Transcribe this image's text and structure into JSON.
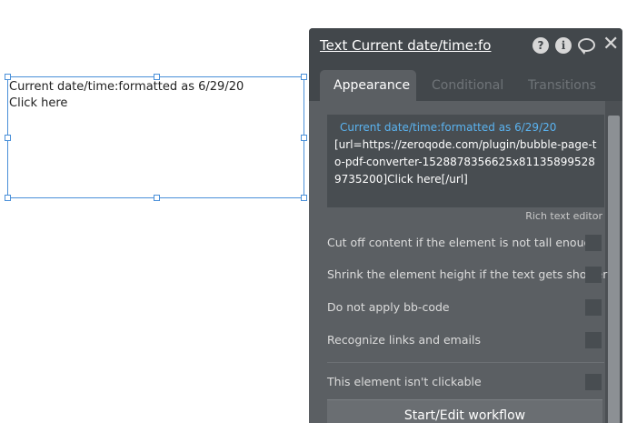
{
  "canvas": {
    "element_text_line1": "Current date/time:formatted as 6/29/20",
    "element_text_line2": "Click here"
  },
  "panel": {
    "title": "Text Current date/time:fo",
    "icons": [
      "help-icon",
      "info-icon",
      "comment-icon",
      "close-icon"
    ],
    "help_glyph": "?",
    "info_glyph": "i",
    "tabs": [
      {
        "label": "Appearance",
        "active": true
      },
      {
        "label": "Conditional",
        "active": false
      },
      {
        "label": "Transitions",
        "active": false
      }
    ],
    "content": {
      "dynamic_text": "Current date/time:formatted as 6/29/20",
      "raw_text": "[url=https://zeroqode.com/plugin/bubble-page-to-pdf-converter-1528878356625x811358995289735200]Click here[/url]"
    },
    "rich_text_editor_label": "Rich text editor",
    "options": [
      {
        "label": "Cut off content if the element is not tall enough",
        "checked": false
      },
      {
        "label": "Shrink the element height if the text gets shorter",
        "checked": false
      },
      {
        "label": "Do not apply bb-code",
        "checked": false
      },
      {
        "label": "Recognize links and emails",
        "checked": false
      },
      {
        "label": "This element isn't clickable",
        "checked": false
      }
    ],
    "workflow_button": "Start/Edit workflow"
  },
  "colors": {
    "selection": "#4a90d9",
    "panel_bg": "#5b5f63",
    "header_bg": "#42474b",
    "dynamic_text": "#5ab3f0"
  }
}
